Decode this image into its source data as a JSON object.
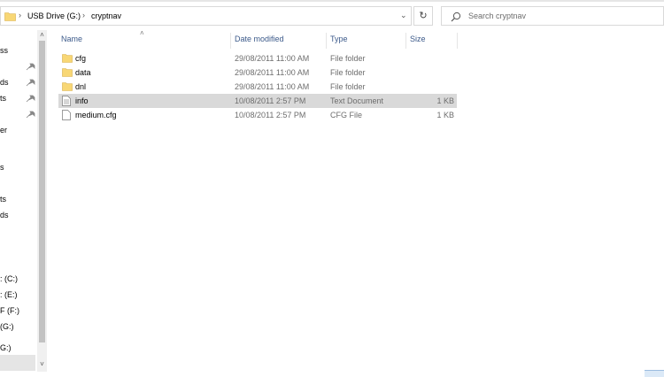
{
  "address": {
    "crumbs": [
      "USB Drive (G:)",
      "cryptnav"
    ],
    "separator": "›"
  },
  "search": {
    "placeholder": "Search cryptnav"
  },
  "columns": {
    "name": "Name",
    "date": "Date modified",
    "type": "Type",
    "size": "Size"
  },
  "nav": {
    "labels": [
      "ss",
      "ds",
      "ts",
      "er",
      "s",
      "ts",
      "ds",
      ": (C:)",
      ": (E:)",
      "F (F:)",
      " (G:)",
      "G:)"
    ],
    "pinned_count": 4
  },
  "files": [
    {
      "name": "cfg",
      "date": "29/08/2011 11:00 AM",
      "type": "File folder",
      "size": "",
      "icon": "folder-icon",
      "selected": false
    },
    {
      "name": "data",
      "date": "29/08/2011 11:00 AM",
      "type": "File folder",
      "size": "",
      "icon": "folder-icon",
      "selected": false
    },
    {
      "name": "dnl",
      "date": "29/08/2011 11:00 AM",
      "type": "File folder",
      "size": "",
      "icon": "folder-icon",
      "selected": false
    },
    {
      "name": "info",
      "date": "10/08/2011 2:57 PM",
      "type": "Text Document",
      "size": "1 KB",
      "icon": "text-document-icon",
      "selected": true
    },
    {
      "name": "medium.cfg",
      "date": "10/08/2011 2:57 PM",
      "type": "CFG File",
      "size": "1 KB",
      "icon": "file-icon",
      "selected": false
    }
  ],
  "colors": {
    "folder": "#f8d775",
    "header_text": "#3c5a8a",
    "selection": "#d9d9d9"
  }
}
